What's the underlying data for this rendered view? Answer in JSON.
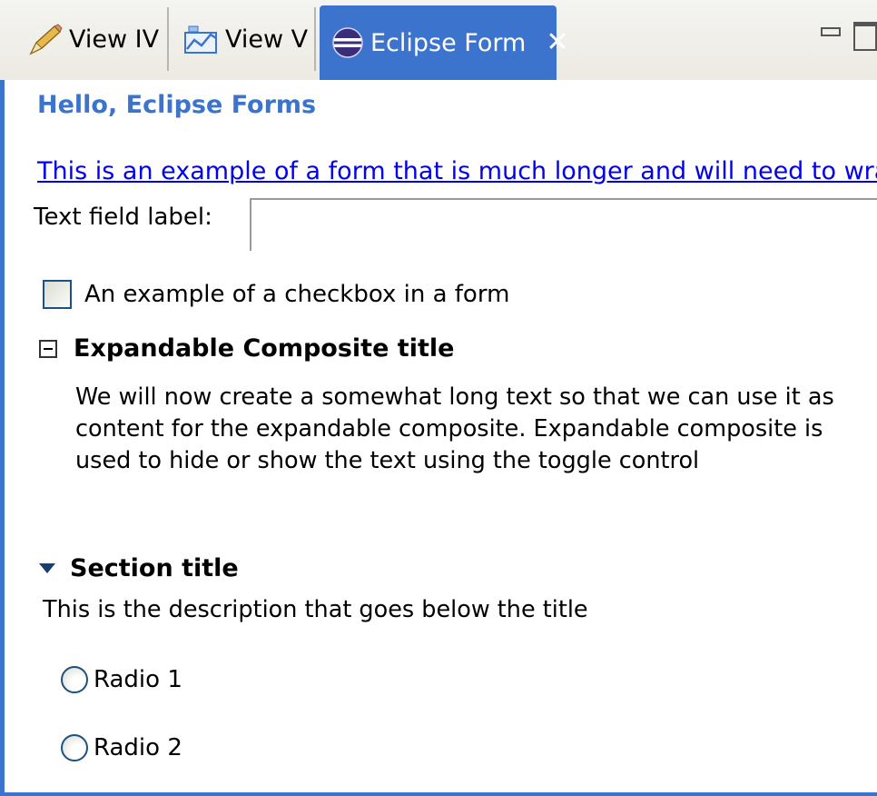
{
  "tabs": [
    {
      "label": "View IV",
      "icon": "pencil-icon",
      "active": false
    },
    {
      "label": "View V",
      "icon": "view-chart-icon",
      "active": false
    },
    {
      "label": "Eclipse Form",
      "icon": "eclipse-globe-icon",
      "active": true,
      "close_glyph": "✕"
    }
  ],
  "form": {
    "title": "Hello, Eclipse Forms",
    "link": "This is an example of a form that is much longer and will need to wrap.",
    "text_field_label": "Text field label:",
    "text_field_value": "",
    "checkbox_label": "An example of a checkbox in a form",
    "checkbox_checked": false
  },
  "expandable": {
    "title": "Expandable Composite title",
    "expanded": true,
    "text": "We will now create a somewhat long text so that we can use it as content for the expandable composite. Expandable composite is used to hide or show the text using the toggle control"
  },
  "section": {
    "title": "Section title",
    "expanded": true,
    "description": "This is the description that goes below the title",
    "radios": [
      {
        "label": "Radio 1",
        "selected": false
      },
      {
        "label": "Radio 2",
        "selected": false
      }
    ]
  },
  "colors": {
    "accent": "#3c73cc",
    "link": "#0000ee",
    "tab_bar": "#eceae2"
  }
}
